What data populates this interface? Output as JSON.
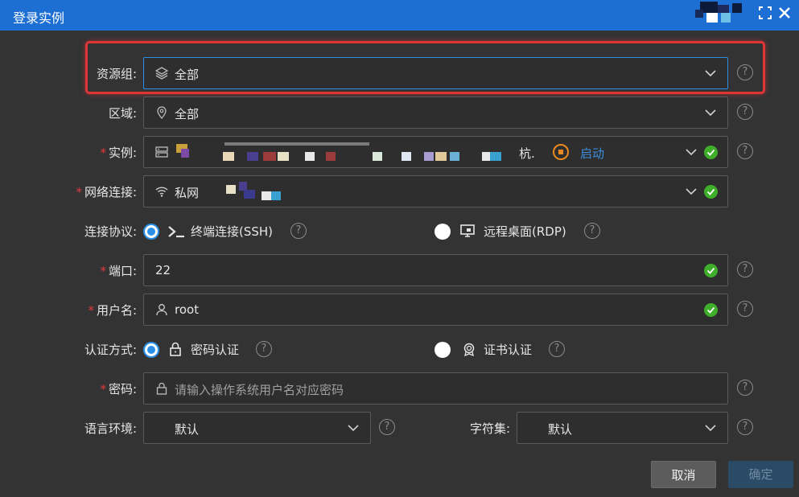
{
  "window": {
    "title": "登录实例"
  },
  "form": {
    "resource_group": {
      "label": "资源组:",
      "value": "全部",
      "icon": "layers-icon"
    },
    "region": {
      "label": "区域:",
      "value": "全部",
      "icon": "location-pin-icon"
    },
    "instance": {
      "label": "实例:",
      "value_suffix": "杭.",
      "action": "启动",
      "required": "*"
    },
    "network": {
      "label": "网络连接:",
      "value": "私网",
      "required": "*"
    },
    "protocol": {
      "label": "连接协议:",
      "options": [
        "终端连接(SSH)",
        "远程桌面(RDP)"
      ],
      "selected": "终端连接(SSH)"
    },
    "port": {
      "label": "端口:",
      "value": "22",
      "required": "*"
    },
    "username": {
      "label": "用户名:",
      "value": "root",
      "required": "*"
    },
    "auth": {
      "label": "认证方式:",
      "options": [
        "密码认证",
        "证书认证"
      ],
      "selected": "密码认证"
    },
    "password": {
      "label": "密码:",
      "placeholder": "请输入操作系统用户名对应密码",
      "required": "*"
    },
    "language": {
      "label": "语言环境:",
      "value": "默认"
    },
    "charset": {
      "label": "字符集:",
      "value": "默认"
    }
  },
  "help_glyph": "?",
  "buttons": {
    "cancel": "取消",
    "confirm": "确定"
  },
  "colors": {
    "titlebar": "#1e6fd3",
    "accent": "#2b8fe6",
    "success": "#3fae2a",
    "required": "#e0393e",
    "highlight": "#e03536",
    "start": "#e98b1e"
  }
}
